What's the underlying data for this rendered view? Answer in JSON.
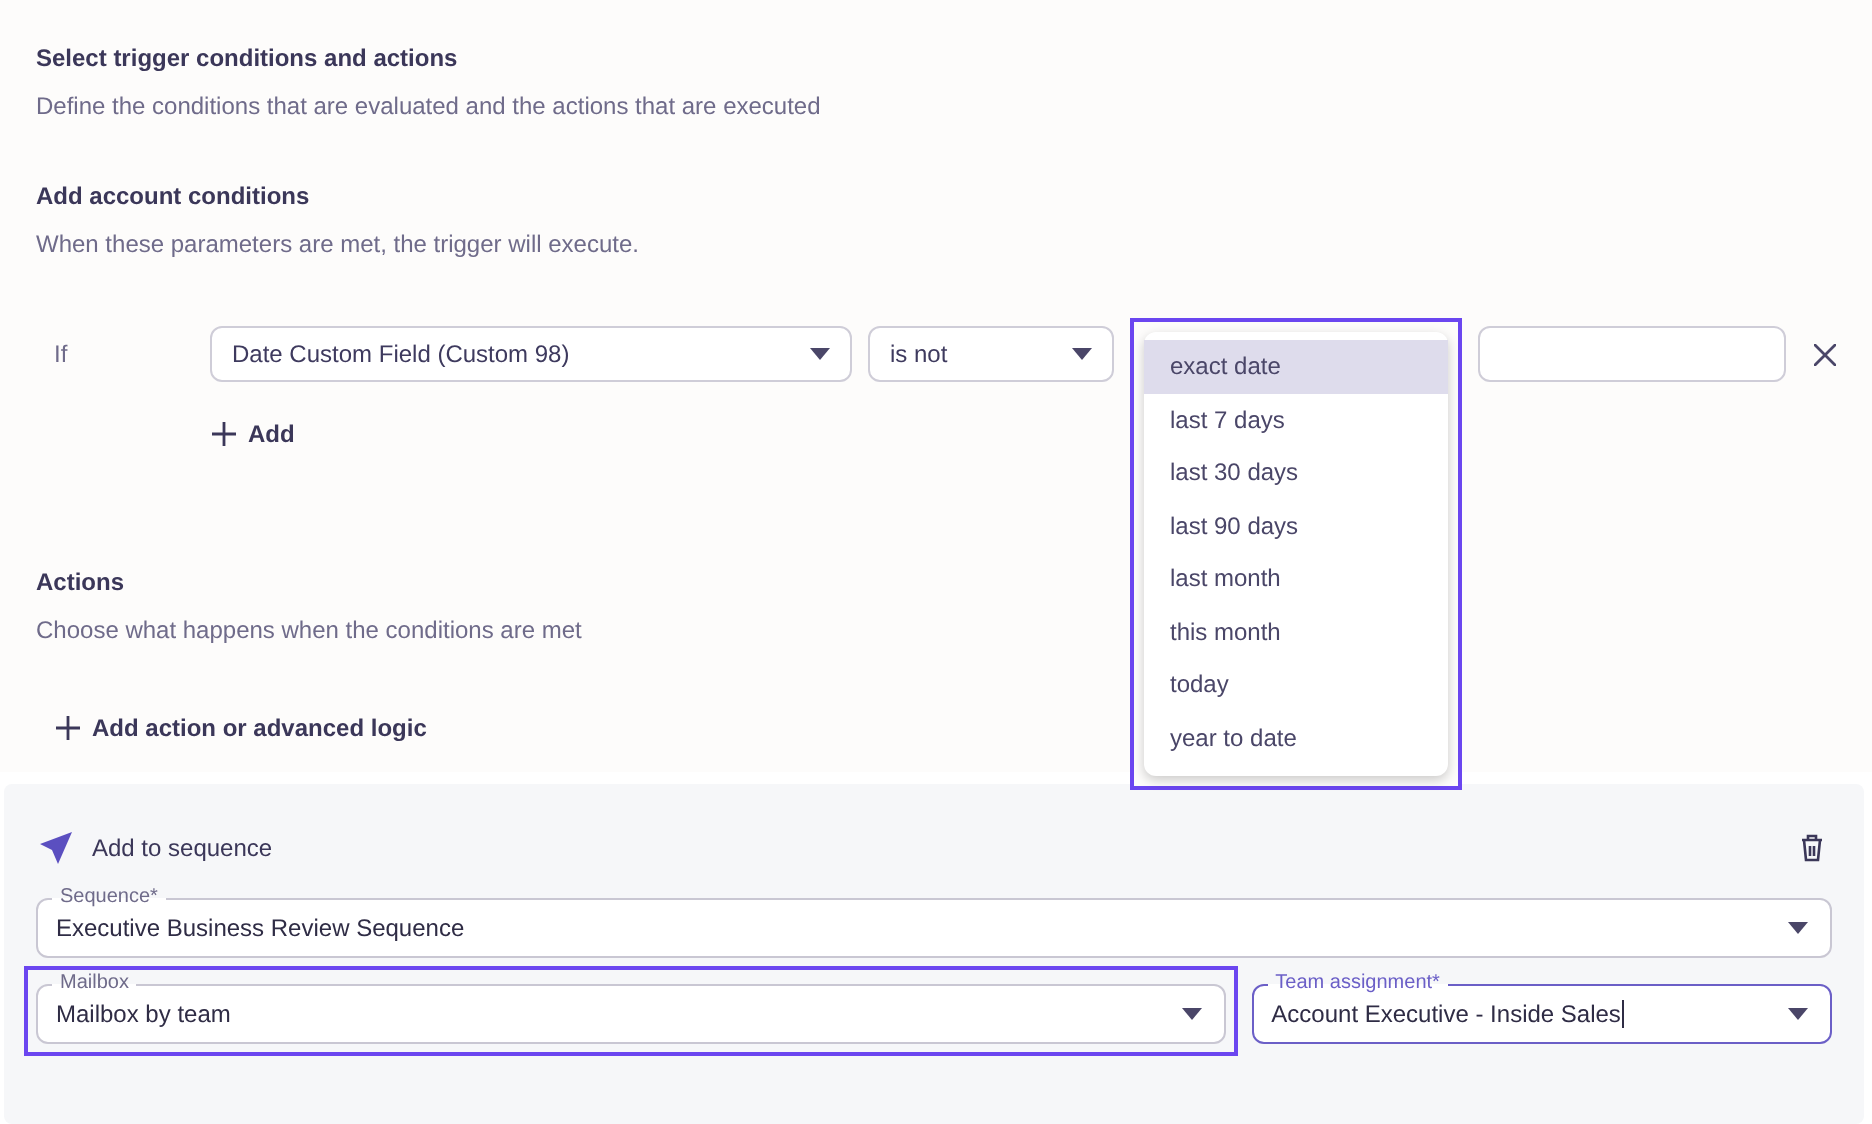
{
  "header": {
    "title": "Select trigger conditions and actions",
    "description": "Define the conditions that are evaluated and the actions that are executed"
  },
  "conditions": {
    "title": "Add account conditions",
    "description": "When these parameters are met, the trigger will execute.",
    "if_label": "If",
    "field": {
      "value": "Date Custom Field (Custom 98)"
    },
    "operator": {
      "value": "is not"
    },
    "date_menu": {
      "highlighted": true,
      "options": [
        {
          "label": "exact date",
          "selected": true
        },
        {
          "label": "last 7 days",
          "selected": false
        },
        {
          "label": "last 30 days",
          "selected": false
        },
        {
          "label": "last 90 days",
          "selected": false
        },
        {
          "label": "last month",
          "selected": false
        },
        {
          "label": "this month",
          "selected": false
        },
        {
          "label": "today",
          "selected": false
        },
        {
          "label": "year to date",
          "selected": false
        }
      ]
    },
    "add_button": "Add"
  },
  "actions": {
    "title": "Actions",
    "description": "Choose what happens when the conditions are met",
    "add_button": "Add action or advanced logic"
  },
  "action_card": {
    "title": "Add to sequence",
    "fields": [
      {
        "label": "Sequence*",
        "value": "Executive Business Review Sequence",
        "focused": false,
        "highlighted": false
      },
      {
        "label": "Mailbox",
        "value": "Mailbox by team",
        "focused": false,
        "highlighted": true
      },
      {
        "label": "Team assignment*",
        "value": "Account Executive - Inside Sales",
        "focused": true,
        "highlighted": false
      }
    ]
  }
}
